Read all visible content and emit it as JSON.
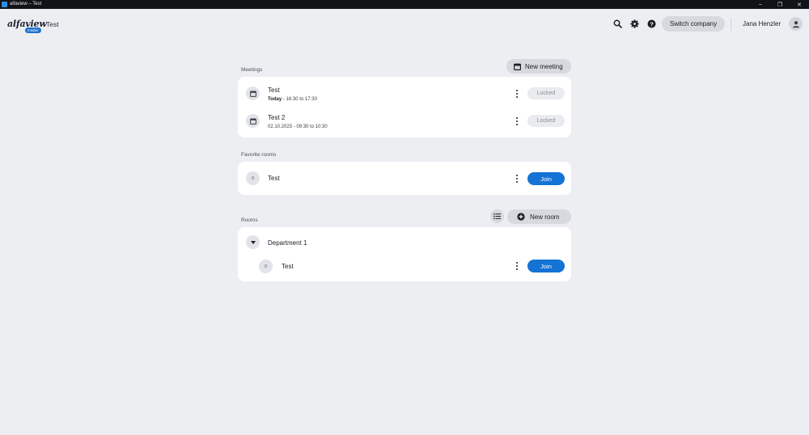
{
  "window": {
    "title": "alfaview – Test",
    "controls": [
      "–",
      "❐",
      "✕"
    ]
  },
  "header": {
    "logo": "alfaview",
    "logo_badge": "Insider",
    "tenant": "Test",
    "icons": [
      "search-icon",
      "gear-icon",
      "help-icon"
    ],
    "switch_company_label": "Switch company",
    "user_name": "Jana Henzler"
  },
  "meetings": {
    "label": "Meetings",
    "new_meeting_label": "New meeting",
    "items": [
      {
        "title": "Test",
        "date_prefix": "Today",
        "time": " - 16:30 to 17:30",
        "status": "Locked"
      },
      {
        "title": "Test 2",
        "date_prefix": "",
        "time": "02.10.2025 - 09:30 to 10:30",
        "status": "Locked"
      }
    ]
  },
  "favorites": {
    "label": "Favorite rooms",
    "items": [
      {
        "count": "0",
        "name": "Test",
        "action": "Join"
      }
    ]
  },
  "rooms": {
    "label": "Rooms",
    "new_room_label": "New room",
    "group": {
      "name": "Department 1",
      "items": [
        {
          "count": "0",
          "name": "Test",
          "action": "Join"
        }
      ]
    }
  },
  "colors": {
    "accent": "#1473d4",
    "background": "#eceef2",
    "card": "#ffffff",
    "pill": "#d7d9df"
  }
}
